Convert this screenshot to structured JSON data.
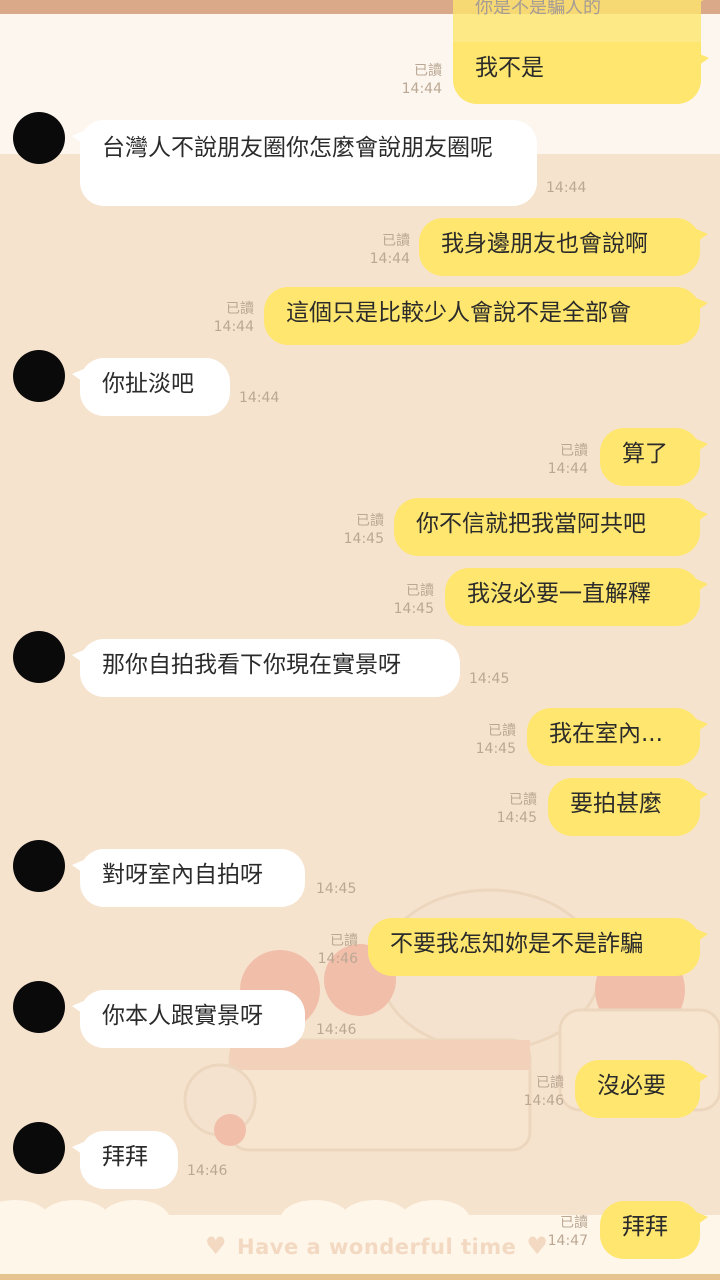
{
  "chat": {
    "messages": [
      {
        "side": "out",
        "read": "",
        "time": "",
        "text": "你是不是騙人的"
      },
      {
        "side": "out",
        "read": "已讀",
        "time": "14:44",
        "text": "我不是"
      },
      {
        "side": "in",
        "time": "14:44",
        "text": "台灣人不說朋友圈你怎麼會說朋友圈呢"
      },
      {
        "side": "out",
        "read": "已讀",
        "time": "14:44",
        "text": "我身邊朋友也會說啊"
      },
      {
        "side": "out",
        "read": "已讀",
        "time": "14:44",
        "text": "這個只是比較少人會說不是全部會"
      },
      {
        "side": "in",
        "time": "14:44",
        "text": "你扯淡吧"
      },
      {
        "side": "out",
        "read": "已讀",
        "time": "14:44",
        "text": "算了"
      },
      {
        "side": "out",
        "read": "已讀",
        "time": "14:45",
        "text": "你不信就把我當阿共吧"
      },
      {
        "side": "out",
        "read": "已讀",
        "time": "14:45",
        "text": "我沒必要一直解釋"
      },
      {
        "side": "in",
        "time": "14:45",
        "text": "那你自拍我看下你現在實景呀"
      },
      {
        "side": "out",
        "read": "已讀",
        "time": "14:45",
        "text": "我在室內..."
      },
      {
        "side": "out",
        "read": "已讀",
        "time": "14:45",
        "text": "要拍甚麼"
      },
      {
        "side": "in",
        "time": "14:45",
        "text": "對呀室內自拍呀"
      },
      {
        "side": "out",
        "read": "已讀",
        "time": "14:46",
        "text": "不要我怎知妳是不是詐騙"
      },
      {
        "side": "in",
        "time": "14:46",
        "text": "你本人跟實景呀"
      },
      {
        "side": "out",
        "read": "已讀",
        "time": "14:46",
        "text": "沒必要"
      },
      {
        "side": "in",
        "time": "14:46",
        "text": "拜拜"
      },
      {
        "side": "out",
        "read": "已讀",
        "time": "14:47",
        "text": "拜拜"
      }
    ]
  },
  "background": {
    "watermark": "Have a wonderful time",
    "heart_icon": "heart-icon"
  },
  "colors": {
    "incoming": "#ffffff",
    "outgoing": "#ffe66e",
    "background": "#f6e3ce",
    "meta": "#bba894"
  }
}
